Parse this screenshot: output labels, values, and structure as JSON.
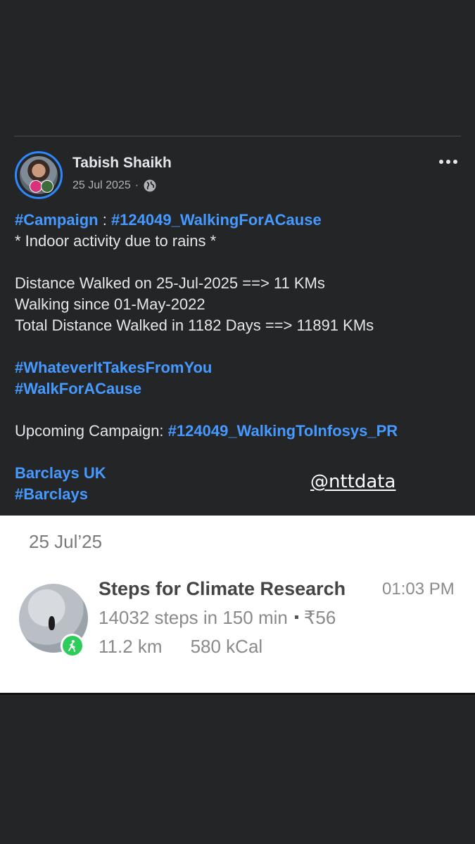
{
  "post": {
    "author": "Tabish Shaikh",
    "date": "25 Jul 2025",
    "separator": "·",
    "privacy_icon": "globe-icon",
    "more_icon": "more-horizontal-icon",
    "lines": {
      "l1_tag1": "#Campaign",
      "l1_sep": " : ",
      "l1_tag2": "#124049_WalkingForACause",
      "l2": "* Indoor activity due to rains *",
      "l3": "Distance Walked on 25-Jul-2025 ==> 11 KMs",
      "l4": "Walking since 01-May-2022",
      "l5": "Total Distance Walked in 1182 Days ==> 11891 KMs",
      "l6": "#WhateverItTakesFromYou",
      "l7": "#WalkForACause",
      "l8_text": "Upcoming Campaign: ",
      "l8_tag": "#124049_WalkingToInfosys_PR",
      "l9": "Barclays UK",
      "l10": "#Barclays"
    },
    "mention": "@nttdata"
  },
  "activity_card": {
    "date": "25 Jul’25",
    "title": "Steps for Climate Research",
    "time": "01:03 PM",
    "steps": "14032 steps in 150 min",
    "amount": "₹56",
    "distance": "11.2 km",
    "calories": "580 kCal",
    "badge_icon": "walking-person-icon"
  },
  "colors": {
    "background": "#242526",
    "link": "#4599ff",
    "text": "#e4e6eb",
    "avatar_ring": "#2d88ff",
    "walk_badge": "#2ecc5a"
  }
}
